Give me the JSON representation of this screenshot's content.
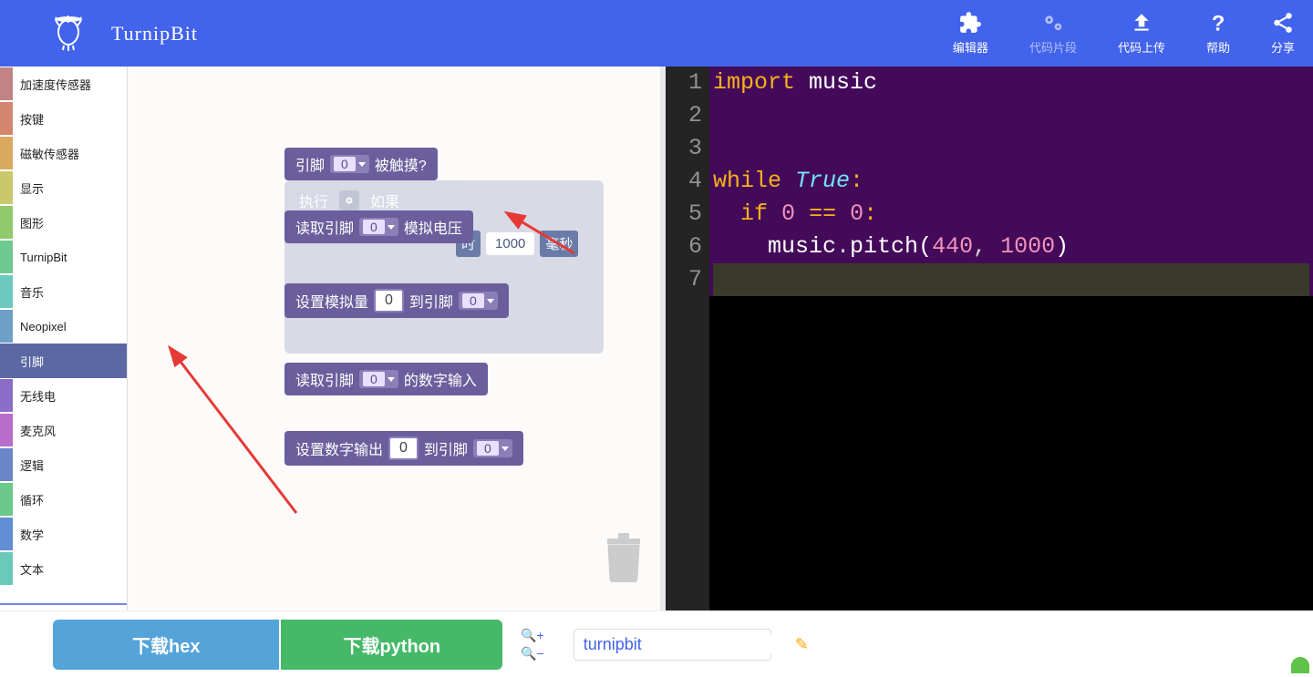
{
  "header": {
    "brand": "TurnipBit",
    "nav": [
      {
        "label": "编辑器",
        "dim": false
      },
      {
        "label": "代码片段",
        "dim": true
      },
      {
        "label": "代码上传",
        "dim": false
      },
      {
        "label": "帮助",
        "dim": false
      },
      {
        "label": "分享",
        "dim": false
      }
    ]
  },
  "sidebar": {
    "items": [
      {
        "label": "加速度传感器",
        "color": "#c18383",
        "active": false
      },
      {
        "label": "按键",
        "color": "#d4856d",
        "active": false
      },
      {
        "label": "磁敏传感器",
        "color": "#d8a95f",
        "active": false
      },
      {
        "label": "显示",
        "color": "#c9c86d",
        "active": false
      },
      {
        "label": "图形",
        "color": "#91c96d",
        "active": false
      },
      {
        "label": "TurnipBit",
        "color": "#6dc990",
        "active": false
      },
      {
        "label": "音乐",
        "color": "#6dc9c0",
        "active": false
      },
      {
        "label": "Neopixel",
        "color": "#6da0c9",
        "active": false
      },
      {
        "label": "引脚",
        "color": "#5C68A4",
        "active": true
      },
      {
        "label": "无线电",
        "color": "#8a6dc9",
        "active": false
      },
      {
        "label": "麦克风",
        "color": "#b76dc9",
        "active": false
      },
      {
        "label": "逻辑",
        "color": "#6a86c9",
        "active": false
      },
      {
        "label": "循环",
        "color": "#6ac98a",
        "active": false
      },
      {
        "label": "数学",
        "color": "#5f8ed4",
        "active": false
      },
      {
        "label": "文本",
        "color": "#6ac9b8",
        "active": false
      }
    ]
  },
  "blocks": {
    "b1_pre": "引脚",
    "b1_dd": "0",
    "b1_post": "被触摸?",
    "b2_pre": "读取引脚",
    "b2_dd": "0",
    "b2_post": "模拟电压",
    "b3_pre": "设置模拟量",
    "b3_num": "0",
    "b3_mid": "到引脚",
    "b3_dd": "0",
    "b4_pre": "读取引脚",
    "b4_dd": "0",
    "b4_post": "的数字输入",
    "b5_pre": "设置数字输出",
    "b5_num": "0",
    "b5_mid": "到引脚",
    "b5_dd": "0"
  },
  "ghost": {
    "exec": "执行",
    "ifw": "如果",
    "t_label": "时",
    "t_num": "1000",
    "t_unit": "毫秒"
  },
  "code": {
    "l1_import": "import",
    "l1_mod": "music",
    "l4_while": "while",
    "l4_true": "True",
    "l5_if": "if",
    "l5_z1": "0",
    "l5_eq": "==",
    "l5_z2": "0",
    "l6_obj": "music",
    "l6_dot": ".",
    "l6_fn": "pitch",
    "l6_a1": "440",
    "l6_a2": "1000",
    "line_numbers": [
      "1",
      "2",
      "3",
      "4",
      "5",
      "6",
      "7"
    ]
  },
  "footer": {
    "hex": "下载hex",
    "py": "下载python",
    "name": "turnipbit"
  }
}
